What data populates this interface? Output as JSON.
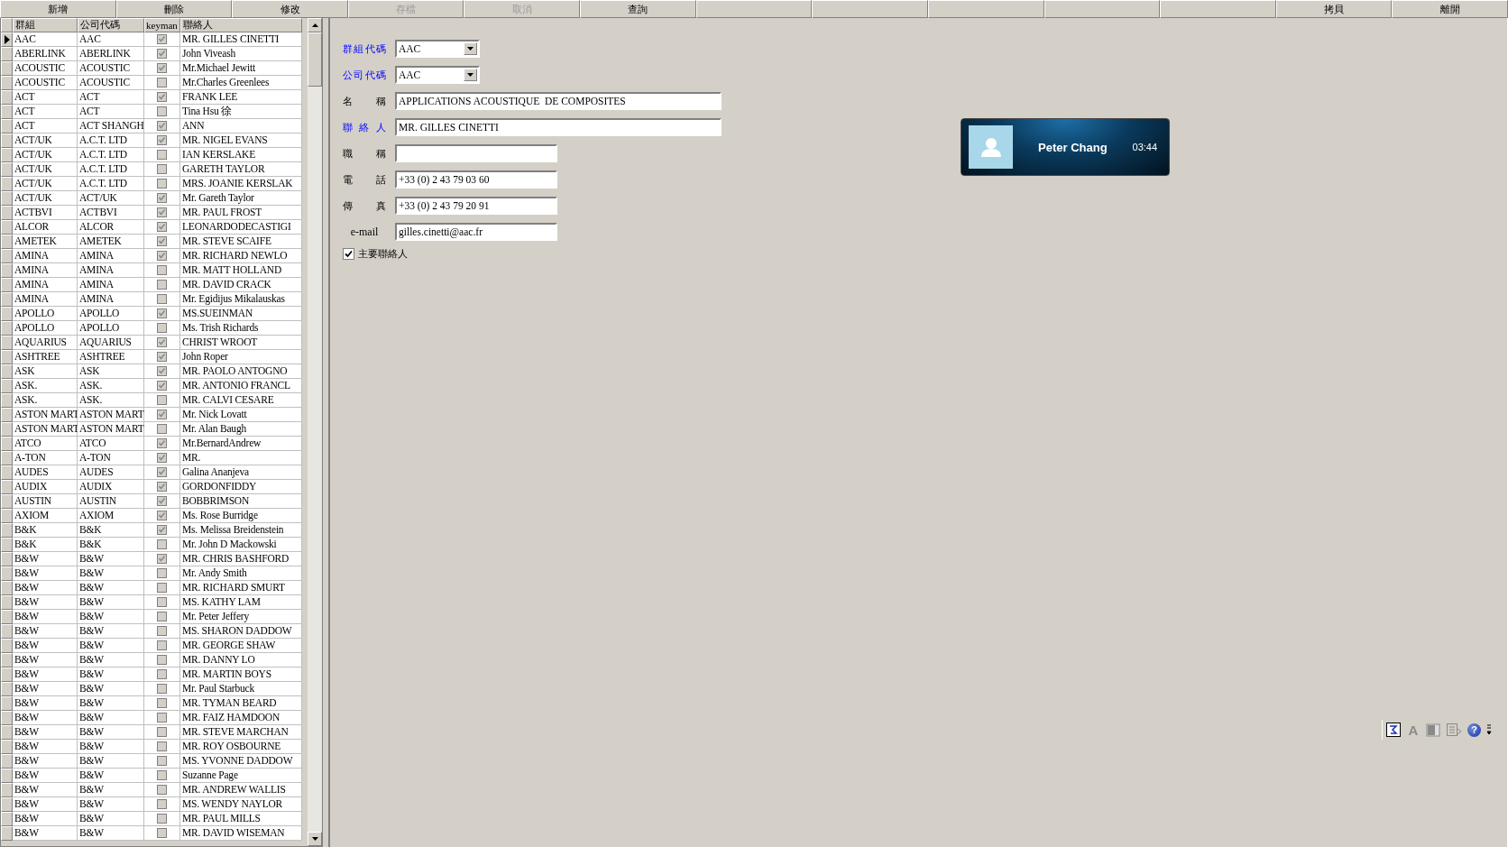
{
  "toolbar": [
    {
      "kind": "label",
      "label": "新增",
      "disabled": false
    },
    {
      "kind": "label",
      "label": "刪除",
      "disabled": false
    },
    {
      "kind": "label",
      "label": "修改",
      "disabled": false
    },
    {
      "kind": "label",
      "label": "存檔",
      "disabled": true
    },
    {
      "kind": "label",
      "label": "取消",
      "disabled": true
    },
    {
      "kind": "label",
      "label": "查詢",
      "disabled": false
    },
    {
      "kind": "blank"
    },
    {
      "kind": "blank"
    },
    {
      "kind": "blank"
    },
    {
      "kind": "blank"
    },
    {
      "kind": "blank"
    },
    {
      "kind": "label",
      "label": "拷貝",
      "disabled": false
    },
    {
      "kind": "label",
      "label": "離開",
      "disabled": false
    }
  ],
  "table": {
    "columns": [
      "群組",
      "公司代碼",
      "keyman",
      "聯絡人"
    ],
    "rows": [
      {
        "selected": true,
        "group": "AAC",
        "company": "AAC",
        "keyman": true,
        "contact": "MR. GILLES CINETTI"
      },
      {
        "selected": false,
        "group": "ABERLINK",
        "company": "ABERLINK",
        "keyman": true,
        "contact": "John Viveash"
      },
      {
        "selected": false,
        "group": "ACOUSTIC",
        "company": "ACOUSTIC",
        "keyman": true,
        "contact": "Mr.Michael Jewitt"
      },
      {
        "selected": false,
        "group": "ACOUSTIC",
        "company": "ACOUSTIC",
        "keyman": false,
        "contact": "Mr.Charles Greenlees"
      },
      {
        "selected": false,
        "group": "ACT",
        "company": "ACT",
        "keyman": true,
        "contact": "FRANK LEE"
      },
      {
        "selected": false,
        "group": "ACT",
        "company": "ACT",
        "keyman": false,
        "contact": "Tina Hsu 徐"
      },
      {
        "selected": false,
        "group": "ACT",
        "company": "ACT SHANGH",
        "keyman": true,
        "contact": "ANN"
      },
      {
        "selected": false,
        "group": "ACT/UK",
        "company": "A.C.T. LTD",
        "keyman": true,
        "contact": "MR. NIGEL EVANS"
      },
      {
        "selected": false,
        "group": "ACT/UK",
        "company": "A.C.T. LTD",
        "keyman": false,
        "contact": "IAN KERSLAKE"
      },
      {
        "selected": false,
        "group": "ACT/UK",
        "company": "A.C.T. LTD",
        "keyman": false,
        "contact": "GARETH TAYLOR"
      },
      {
        "selected": false,
        "group": "ACT/UK",
        "company": "A.C.T. LTD",
        "keyman": false,
        "contact": "MRS. JOANIE KERSLAK"
      },
      {
        "selected": false,
        "group": "ACT/UK",
        "company": "ACT/UK",
        "keyman": true,
        "contact": "Mr. Gareth Taylor"
      },
      {
        "selected": false,
        "group": "ACTBVI",
        "company": "ACTBVI",
        "keyman": true,
        "contact": "MR. PAUL FROST"
      },
      {
        "selected": false,
        "group": "ALCOR",
        "company": "ALCOR",
        "keyman": true,
        "contact": "LEONARDODECASTIGI"
      },
      {
        "selected": false,
        "group": "AMETEK",
        "company": "AMETEK",
        "keyman": true,
        "contact": "MR. STEVE SCAIFE"
      },
      {
        "selected": false,
        "group": "AMINA",
        "company": "AMINA",
        "keyman": true,
        "contact": "MR. RICHARD NEWLO"
      },
      {
        "selected": false,
        "group": "AMINA",
        "company": "AMINA",
        "keyman": false,
        "contact": "MR. MATT HOLLAND"
      },
      {
        "selected": false,
        "group": "AMINA",
        "company": "AMINA",
        "keyman": false,
        "contact": "MR. DAVID CRACK"
      },
      {
        "selected": false,
        "group": "AMINA",
        "company": "AMINA",
        "keyman": false,
        "contact": "Mr. Egidijus Mikalauskas"
      },
      {
        "selected": false,
        "group": "APOLLO",
        "company": "APOLLO",
        "keyman": true,
        "contact": "MS.SUEINMAN"
      },
      {
        "selected": false,
        "group": "APOLLO",
        "company": "APOLLO",
        "keyman": false,
        "contact": "Ms. Trish Richards"
      },
      {
        "selected": false,
        "group": "AQUARIUS",
        "company": "AQUARIUS",
        "keyman": true,
        "contact": "CHRIST WROOT"
      },
      {
        "selected": false,
        "group": "ASHTREE",
        "company": "ASHTREE",
        "keyman": true,
        "contact": "John Roper"
      },
      {
        "selected": false,
        "group": "ASK",
        "company": "ASK",
        "keyman": true,
        "contact": "MR. PAOLO ANTOGNO"
      },
      {
        "selected": false,
        "group": "ASK.",
        "company": "ASK.",
        "keyman": true,
        "contact": "MR. ANTONIO FRANCL"
      },
      {
        "selected": false,
        "group": "ASK.",
        "company": "ASK.",
        "keyman": false,
        "contact": "MR. CALVI CESARE"
      },
      {
        "selected": false,
        "group": "ASTON MART",
        "company": "ASTON MART",
        "keyman": true,
        "contact": "Mr. Nick Lovatt"
      },
      {
        "selected": false,
        "group": "ASTON MART",
        "company": "ASTON MART",
        "keyman": false,
        "contact": "Mr. Alan Baugh"
      },
      {
        "selected": false,
        "group": "ATCO",
        "company": "ATCO",
        "keyman": true,
        "contact": "Mr.BernardAndrew"
      },
      {
        "selected": false,
        "group": "A-TON",
        "company": "A-TON",
        "keyman": true,
        "contact": "MR."
      },
      {
        "selected": false,
        "group": "AUDES",
        "company": "AUDES",
        "keyman": true,
        "contact": "Galina Ananjeva"
      },
      {
        "selected": false,
        "group": "AUDIX",
        "company": "AUDIX",
        "keyman": true,
        "contact": "GORDONFIDDY"
      },
      {
        "selected": false,
        "group": "AUSTIN",
        "company": "AUSTIN",
        "keyman": true,
        "contact": "BOBBRIMSON"
      },
      {
        "selected": false,
        "group": "AXIOM",
        "company": "AXIOM",
        "keyman": true,
        "contact": "Ms. Rose Burridge"
      },
      {
        "selected": false,
        "group": "B&K",
        "company": "B&K",
        "keyman": true,
        "contact": "Ms. Melissa Breidenstein"
      },
      {
        "selected": false,
        "group": "B&K",
        "company": "B&K",
        "keyman": false,
        "contact": "Mr. John D Mackowski"
      },
      {
        "selected": false,
        "group": "B&W",
        "company": "B&W",
        "keyman": true,
        "contact": "MR. CHRIS BASHFORD"
      },
      {
        "selected": false,
        "group": "B&W",
        "company": "B&W",
        "keyman": false,
        "contact": "Mr. Andy Smith"
      },
      {
        "selected": false,
        "group": "B&W",
        "company": "B&W",
        "keyman": false,
        "contact": "MR. RICHARD SMURT"
      },
      {
        "selected": false,
        "group": "B&W",
        "company": "B&W",
        "keyman": false,
        "contact": "MS. KATHY LAM"
      },
      {
        "selected": false,
        "group": "B&W",
        "company": "B&W",
        "keyman": false,
        "contact": "Mr. Peter Jeffery"
      },
      {
        "selected": false,
        "group": "B&W",
        "company": "B&W",
        "keyman": false,
        "contact": "MS. SHARON DADDOW"
      },
      {
        "selected": false,
        "group": "B&W",
        "company": "B&W",
        "keyman": false,
        "contact": "MR. GEORGE SHAW"
      },
      {
        "selected": false,
        "group": "B&W",
        "company": "B&W",
        "keyman": false,
        "contact": "MR. DANNY LO"
      },
      {
        "selected": false,
        "group": "B&W",
        "company": "B&W",
        "keyman": false,
        "contact": "MR. MARTIN BOYS"
      },
      {
        "selected": false,
        "group": "B&W",
        "company": "B&W",
        "keyman": false,
        "contact": "Mr. Paul Starbuck"
      },
      {
        "selected": false,
        "group": "B&W",
        "company": "B&W",
        "keyman": false,
        "contact": "MR. TYMAN BEARD"
      },
      {
        "selected": false,
        "group": "B&W",
        "company": "B&W",
        "keyman": false,
        "contact": "MR. FAIZ HAMDOON"
      },
      {
        "selected": false,
        "group": "B&W",
        "company": "B&W",
        "keyman": false,
        "contact": "MR. STEVE MARCHAN"
      },
      {
        "selected": false,
        "group": "B&W",
        "company": "B&W",
        "keyman": false,
        "contact": "MR. ROY OSBOURNE"
      },
      {
        "selected": false,
        "group": "B&W",
        "company": "B&W",
        "keyman": false,
        "contact": "MS. YVONNE DADDOW"
      },
      {
        "selected": false,
        "group": "B&W",
        "company": "B&W",
        "keyman": false,
        "contact": "Suzanne Page"
      },
      {
        "selected": false,
        "group": "B&W",
        "company": "B&W",
        "keyman": false,
        "contact": "MR. ANDREW WALLIS"
      },
      {
        "selected": false,
        "group": "B&W",
        "company": "B&W",
        "keyman": false,
        "contact": "MS. WENDY NAYLOR"
      },
      {
        "selected": false,
        "group": "B&W",
        "company": "B&W",
        "keyman": false,
        "contact": "MR. PAUL MILLS"
      },
      {
        "selected": false,
        "group": "B&W",
        "company": "B&W",
        "keyman": false,
        "contact": "MR. DAVID WISEMAN"
      }
    ]
  },
  "form": {
    "fields": [
      {
        "kind": "dropdown",
        "label": "群組代碼",
        "value": "AAC",
        "required": true
      },
      {
        "kind": "dropdown",
        "label": "公司代碼",
        "value": "AAC",
        "required": true
      },
      {
        "kind": "wide",
        "label": "名 稱",
        "value": "APPLICATIONS ACOUSTIQUE  DE COMPOSITES",
        "required": false
      },
      {
        "kind": "wide",
        "label": "聯 絡 人",
        "value": "MR. GILLES CINETTI",
        "required": true
      },
      {
        "kind": "short",
        "label": "職 稱",
        "required": false
      },
      {
        "kind": "short",
        "label": "電 話",
        "value": "+33 (0) 2 43 79 03 60",
        "required": false
      },
      {
        "kind": "short",
        "label": "傳 真",
        "value": "+33 (0) 2 43 79 20 91",
        "required": false
      },
      {
        "kind": "short",
        "label": "e-mail",
        "value": "gilles.cinetti@aac.fr",
        "required": false
      }
    ],
    "primary_contact": {
      "label": "主要聯絡人",
      "checked": true
    }
  },
  "call_popup": {
    "name": "Peter Chang",
    "time": "03:44"
  },
  "mini_toolbar": [
    {
      "kind": "frame",
      "disabled": false
    },
    {
      "kind": "font",
      "glyph": "A",
      "disabled": true
    },
    {
      "kind": "block",
      "disabled": true
    },
    {
      "kind": "doc",
      "disabled": true
    },
    {
      "kind": "help",
      "glyph": "?",
      "disabled": false
    }
  ]
}
